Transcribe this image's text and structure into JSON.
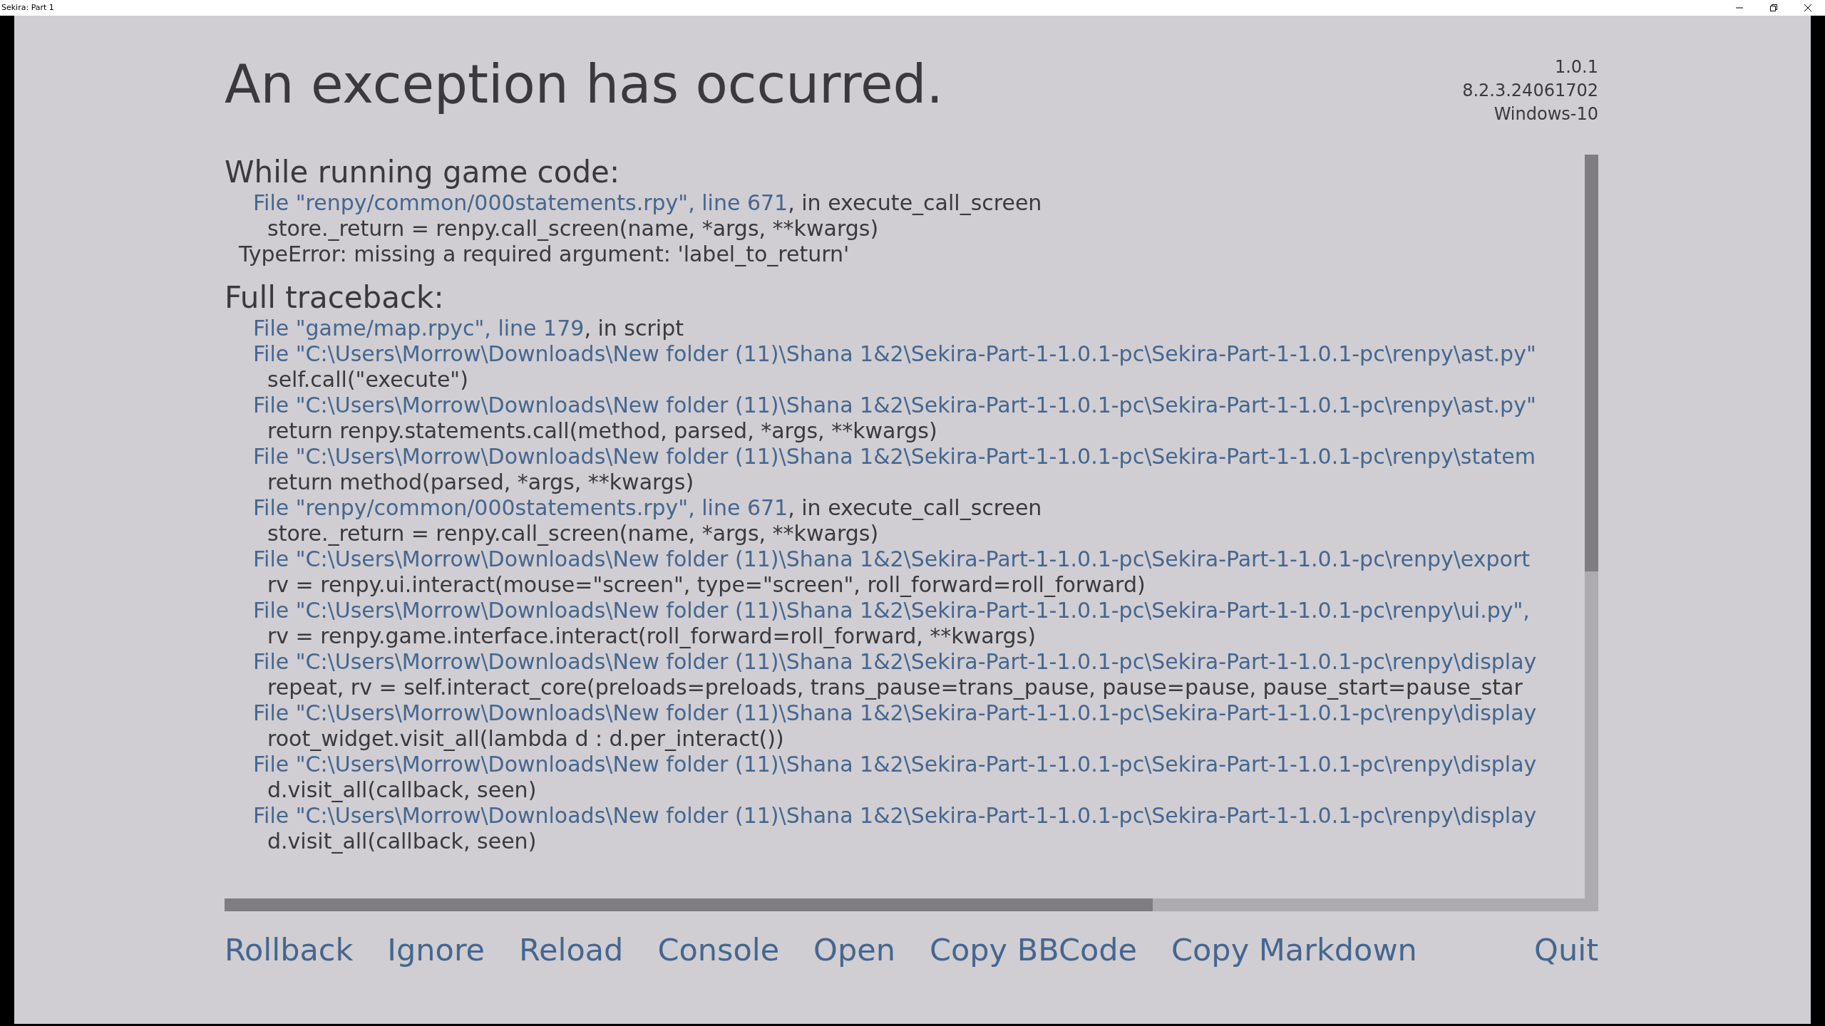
{
  "window": {
    "title": "Sekira: Part 1"
  },
  "title": "An exception has occurred.",
  "version_info": [
    "1.0.1",
    "8.2.3.24061702",
    "Windows-10"
  ],
  "sections": [
    {
      "heading": "While running game code:",
      "lines": [
        {
          "kind": "file",
          "link": "File \"renpy/common/000statements.rpy\", line 671",
          "rest": ", in execute_call_screen"
        },
        {
          "kind": "code",
          "text": "store._return = renpy.call_screen(name, *args, **kwargs)"
        },
        {
          "kind": "error",
          "text": "TypeError: missing a required argument: 'label_to_return'"
        }
      ]
    },
    {
      "heading": "Full traceback:",
      "lines": [
        {
          "kind": "file",
          "link": "File \"game/map.rpyc\", line 179",
          "rest": ", in script"
        },
        {
          "kind": "file",
          "link": "File \"C:\\Users\\Morrow\\Downloads\\New folder (11)\\Shana 1&2\\Sekira-Part-1-1.0.1-pc\\Sekira-Part-1-1.0.1-pc\\renpy\\ast.py\""
        },
        {
          "kind": "code",
          "text": "self.call(\"execute\")"
        },
        {
          "kind": "file",
          "link": "File \"C:\\Users\\Morrow\\Downloads\\New folder (11)\\Shana 1&2\\Sekira-Part-1-1.0.1-pc\\Sekira-Part-1-1.0.1-pc\\renpy\\ast.py\""
        },
        {
          "kind": "code",
          "text": "return renpy.statements.call(method, parsed, *args, **kwargs)"
        },
        {
          "kind": "file",
          "link": "File \"C:\\Users\\Morrow\\Downloads\\New folder (11)\\Shana 1&2\\Sekira-Part-1-1.0.1-pc\\Sekira-Part-1-1.0.1-pc\\renpy\\statem"
        },
        {
          "kind": "code",
          "text": "return method(parsed, *args, **kwargs)"
        },
        {
          "kind": "file",
          "link": "File \"renpy/common/000statements.rpy\", line 671",
          "rest": ", in execute_call_screen"
        },
        {
          "kind": "code",
          "text": "store._return = renpy.call_screen(name, *args, **kwargs)"
        },
        {
          "kind": "file",
          "link": "File \"C:\\Users\\Morrow\\Downloads\\New folder (11)\\Shana 1&2\\Sekira-Part-1-1.0.1-pc\\Sekira-Part-1-1.0.1-pc\\renpy\\export"
        },
        {
          "kind": "code",
          "text": "rv = renpy.ui.interact(mouse=\"screen\", type=\"screen\", roll_forward=roll_forward)"
        },
        {
          "kind": "file",
          "link": "File \"C:\\Users\\Morrow\\Downloads\\New folder (11)\\Shana 1&2\\Sekira-Part-1-1.0.1-pc\\Sekira-Part-1-1.0.1-pc\\renpy\\ui.py\","
        },
        {
          "kind": "code",
          "text": "rv = renpy.game.interface.interact(roll_forward=roll_forward, **kwargs)"
        },
        {
          "kind": "file",
          "link": "File \"C:\\Users\\Morrow\\Downloads\\New folder (11)\\Shana 1&2\\Sekira-Part-1-1.0.1-pc\\Sekira-Part-1-1.0.1-pc\\renpy\\display"
        },
        {
          "kind": "code",
          "text": "repeat, rv = self.interact_core(preloads=preloads, trans_pause=trans_pause, pause=pause, pause_start=pause_star"
        },
        {
          "kind": "file",
          "link": "File \"C:\\Users\\Morrow\\Downloads\\New folder (11)\\Shana 1&2\\Sekira-Part-1-1.0.1-pc\\Sekira-Part-1-1.0.1-pc\\renpy\\display"
        },
        {
          "kind": "code",
          "text": "root_widget.visit_all(lambda d : d.per_interact())"
        },
        {
          "kind": "file",
          "link": "File \"C:\\Users\\Morrow\\Downloads\\New folder (11)\\Shana 1&2\\Sekira-Part-1-1.0.1-pc\\Sekira-Part-1-1.0.1-pc\\renpy\\display"
        },
        {
          "kind": "code",
          "text": "d.visit_all(callback, seen)"
        },
        {
          "kind": "file",
          "link": "File \"C:\\Users\\Morrow\\Downloads\\New folder (11)\\Shana 1&2\\Sekira-Part-1-1.0.1-pc\\Sekira-Part-1-1.0.1-pc\\renpy\\display"
        },
        {
          "kind": "code",
          "text": "d.visit_all(callback, seen)"
        }
      ]
    }
  ],
  "buttons": [
    "Rollback",
    "Ignore",
    "Reload",
    "Console",
    "Open",
    "Copy BBCode",
    "Copy Markdown"
  ],
  "quit_button": "Quit"
}
